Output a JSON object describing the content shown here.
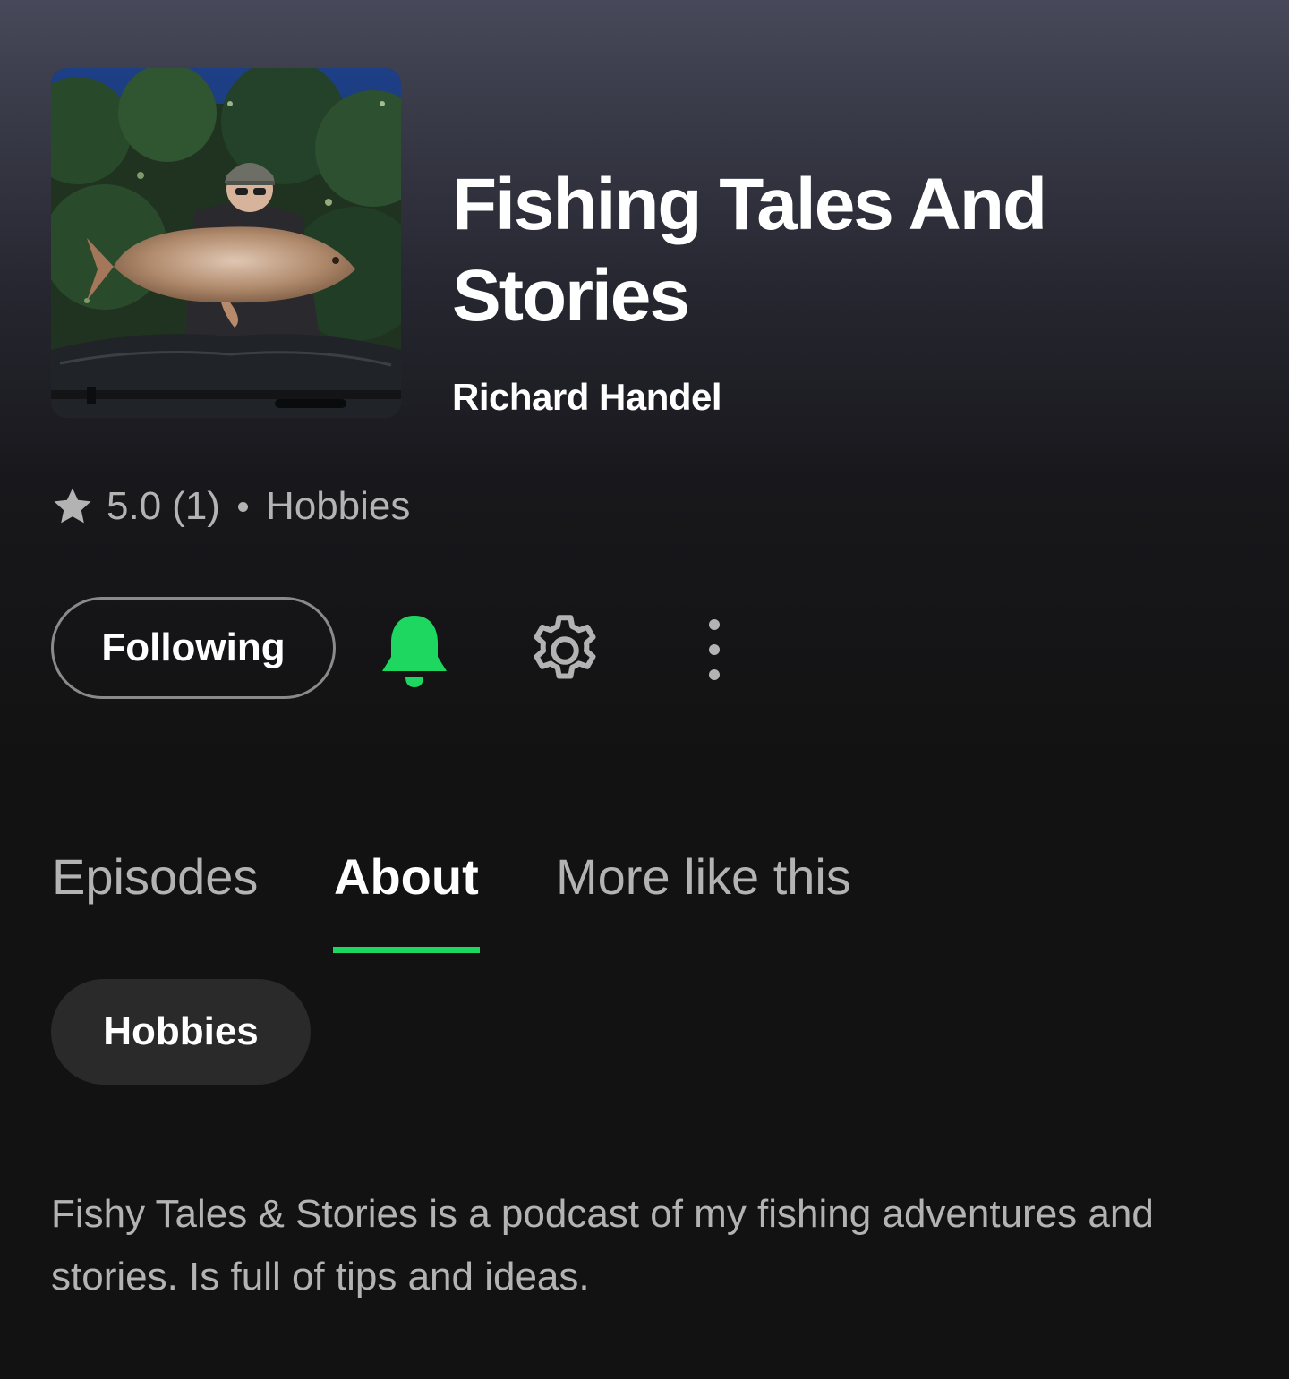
{
  "podcast": {
    "title": "Fishing Tales And Stories",
    "author": "Richard Handel",
    "rating": "5.0",
    "rating_count": "(1)",
    "category": "Hobbies",
    "cover_image": "angler holding a large carp at night"
  },
  "actions": {
    "follow_label": "Following",
    "bell_icon": "bell-icon",
    "settings_icon": "gear-icon",
    "more_icon": "more-vertical-icon"
  },
  "tabs": [
    {
      "label": "Episodes",
      "active": false
    },
    {
      "label": "About",
      "active": true
    },
    {
      "label": "More like this",
      "active": false
    }
  ],
  "about": {
    "chip_label": "Hobbies",
    "description": "Fishy Tales & Stories is a podcast of my fishing adventures and stories. Is full of tips and ideas."
  },
  "colors": {
    "accent": "#1ed760",
    "background": "#121212",
    "header_top": "#474859",
    "secondary_text": "#b3b3b3",
    "chip_bg": "#2a2a2a"
  }
}
